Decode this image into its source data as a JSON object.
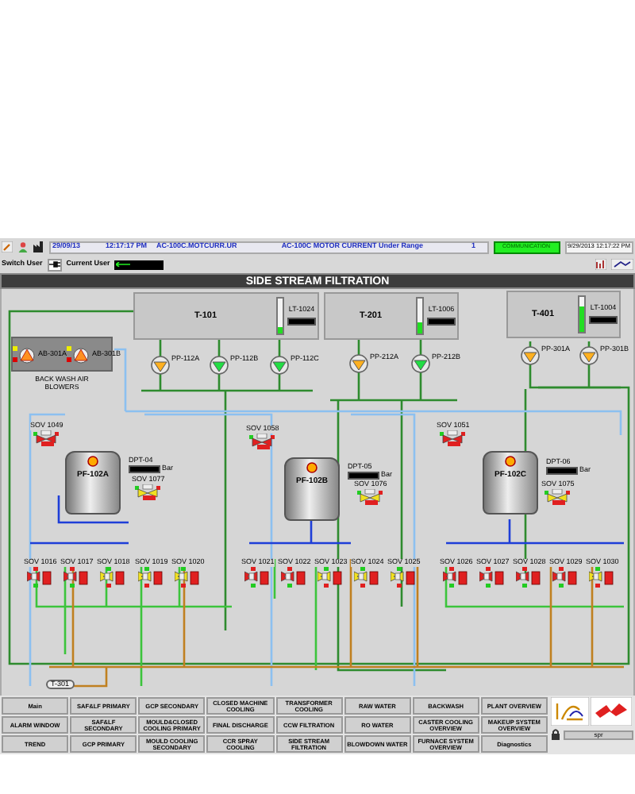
{
  "alarm_bar": {
    "date": "29/09/13",
    "time": "12:17:17 PM",
    "tag": "AC-100C.MOTCURR.UR",
    "message": "AC-100C MOTOR CURRENT  Under Range",
    "count": "1",
    "status": "COMMUNICATION",
    "timestamp": "9/29/2013 12:17:22 PM"
  },
  "user_bar": {
    "switch_user": "Switch User",
    "current_user": "Current User"
  },
  "title": "SIDE STREAM FILTRATION",
  "tanks": [
    {
      "name": "T-101",
      "transmitter": "LT-1024",
      "level": 0.2
    },
    {
      "name": "T-201",
      "transmitter": "LT-1006",
      "level": 0.3
    },
    {
      "name": "T-401",
      "transmitter": "LT-1004",
      "level": 0.75
    }
  ],
  "blowers": {
    "caption": "BACK WASH AIR BLOWERS",
    "items": [
      {
        "name": "AB-301A",
        "running": false
      },
      {
        "name": "AB-301B",
        "running": false
      }
    ]
  },
  "pumps": [
    {
      "name": "PP-112A",
      "running": false
    },
    {
      "name": "PP-112B",
      "running": true
    },
    {
      "name": "PP-112C",
      "running": true
    },
    {
      "name": "PP-212A",
      "running": false
    },
    {
      "name": "PP-212B",
      "running": true
    },
    {
      "name": "PP-301A",
      "running": false
    },
    {
      "name": "PP-301B",
      "running": false
    }
  ],
  "filters": [
    {
      "name": "PF-102A",
      "dpt": "DPT-04",
      "unit": "Bar",
      "inlet_valve": {
        "name": "SOV 1049",
        "open": false
      },
      "outlet_valve": {
        "name": "SOV 1077",
        "open": true
      },
      "valves": [
        {
          "name": "SOV 1016",
          "open": false
        },
        {
          "name": "SOV 1017",
          "open": false
        },
        {
          "name": "SOV 1018",
          "open": true
        },
        {
          "name": "SOV 1019",
          "open": true
        },
        {
          "name": "SOV 1020",
          "open": true
        }
      ]
    },
    {
      "name": "PF-102B",
      "dpt": "DPT-05",
      "unit": "Bar",
      "inlet_valve": {
        "name": "SOV 1058",
        "open": false
      },
      "outlet_valve": {
        "name": "SOV 1076",
        "open": true
      },
      "valves": [
        {
          "name": "SOV 1021",
          "open": false
        },
        {
          "name": "SOV 1022",
          "open": false
        },
        {
          "name": "SOV 1023",
          "open": true
        },
        {
          "name": "SOV 1024",
          "open": true
        },
        {
          "name": "SOV 1025",
          "open": true
        }
      ]
    },
    {
      "name": "PF-102C",
      "dpt": "DPT-06",
      "unit": "Bar",
      "inlet_valve": {
        "name": "SOV 1051",
        "open": false
      },
      "outlet_valve": {
        "name": "SOV 1075",
        "open": true
      },
      "valves": [
        {
          "name": "SOV 1026",
          "open": false
        },
        {
          "name": "SOV 1027",
          "open": false
        },
        {
          "name": "SOV 1028",
          "open": false
        },
        {
          "name": "SOV 1029",
          "open": false
        },
        {
          "name": "SOV 1030",
          "open": true
        }
      ]
    }
  ],
  "drain_tank": "T-301",
  "nav_buttons": [
    [
      "Main",
      "SAF&LF PRIMARY",
      "GCP SECONDARY",
      "CLOSED MACHINE COOLING",
      "TRANSFORMER COOLING",
      "RAW WATER",
      "BACKWASH",
      "PLANT OVERVIEW"
    ],
    [
      "ALARM WINDOW",
      "SAF&LF SECONDARY",
      "MOULD&CLOSED COOLING PRIMARY",
      "FINAL DISCHARGE",
      "CCW FILTRATION",
      "RO WATER",
      "CASTER COOLING OVERVIEW",
      "MAKEUP SYSTEM OVERVIEW"
    ],
    [
      "TREND",
      "GCP PRIMARY",
      "MOULD COOLING SECONDARY",
      "CCR SPRAY COOLING",
      "SIDE STREAM FILTRATION",
      "BLOWDOWN WATER",
      "FURNACE SYSTEM OVERVIEW",
      "Diagnostics"
    ]
  ],
  "user_field": {
    "value": "spr"
  }
}
